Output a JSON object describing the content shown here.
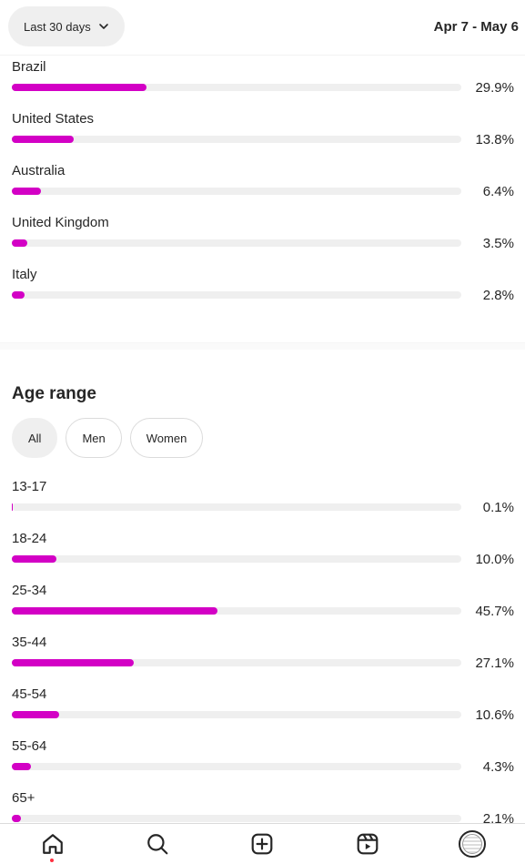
{
  "header": {
    "range_label": "Last 30 days",
    "date_range": "Apr 7 - May 6"
  },
  "countries": [
    {
      "label": "Brazil",
      "value": "29.9%",
      "fraction": 0.299
    },
    {
      "label": "United States",
      "value": "13.8%",
      "fraction": 0.138
    },
    {
      "label": "Australia",
      "value": "6.4%",
      "fraction": 0.064
    },
    {
      "label": "United Kingdom",
      "value": "3.5%",
      "fraction": 0.035
    },
    {
      "label": "Italy",
      "value": "2.8%",
      "fraction": 0.028
    }
  ],
  "age": {
    "title": "Age range",
    "filters": [
      "All",
      "Men",
      "Women"
    ],
    "active_filter": "All",
    "rows": [
      {
        "label": "13-17",
        "value": "0.1%",
        "fraction": 0.001
      },
      {
        "label": "18-24",
        "value": "10.0%",
        "fraction": 0.1
      },
      {
        "label": "25-34",
        "value": "45.7%",
        "fraction": 0.457
      },
      {
        "label": "35-44",
        "value": "27.1%",
        "fraction": 0.271
      },
      {
        "label": "45-54",
        "value": "10.6%",
        "fraction": 0.106
      },
      {
        "label": "55-64",
        "value": "4.3%",
        "fraction": 0.043
      },
      {
        "label": "65+",
        "value": "2.1%",
        "fraction": 0.021
      }
    ]
  },
  "colors": {
    "bar": "#d300c5",
    "track": "#efefef",
    "notification_dot": "#ff3040"
  },
  "nav": {
    "icons": [
      "home-icon",
      "search-icon",
      "create-icon",
      "reels-icon",
      "profile-avatar"
    ]
  }
}
